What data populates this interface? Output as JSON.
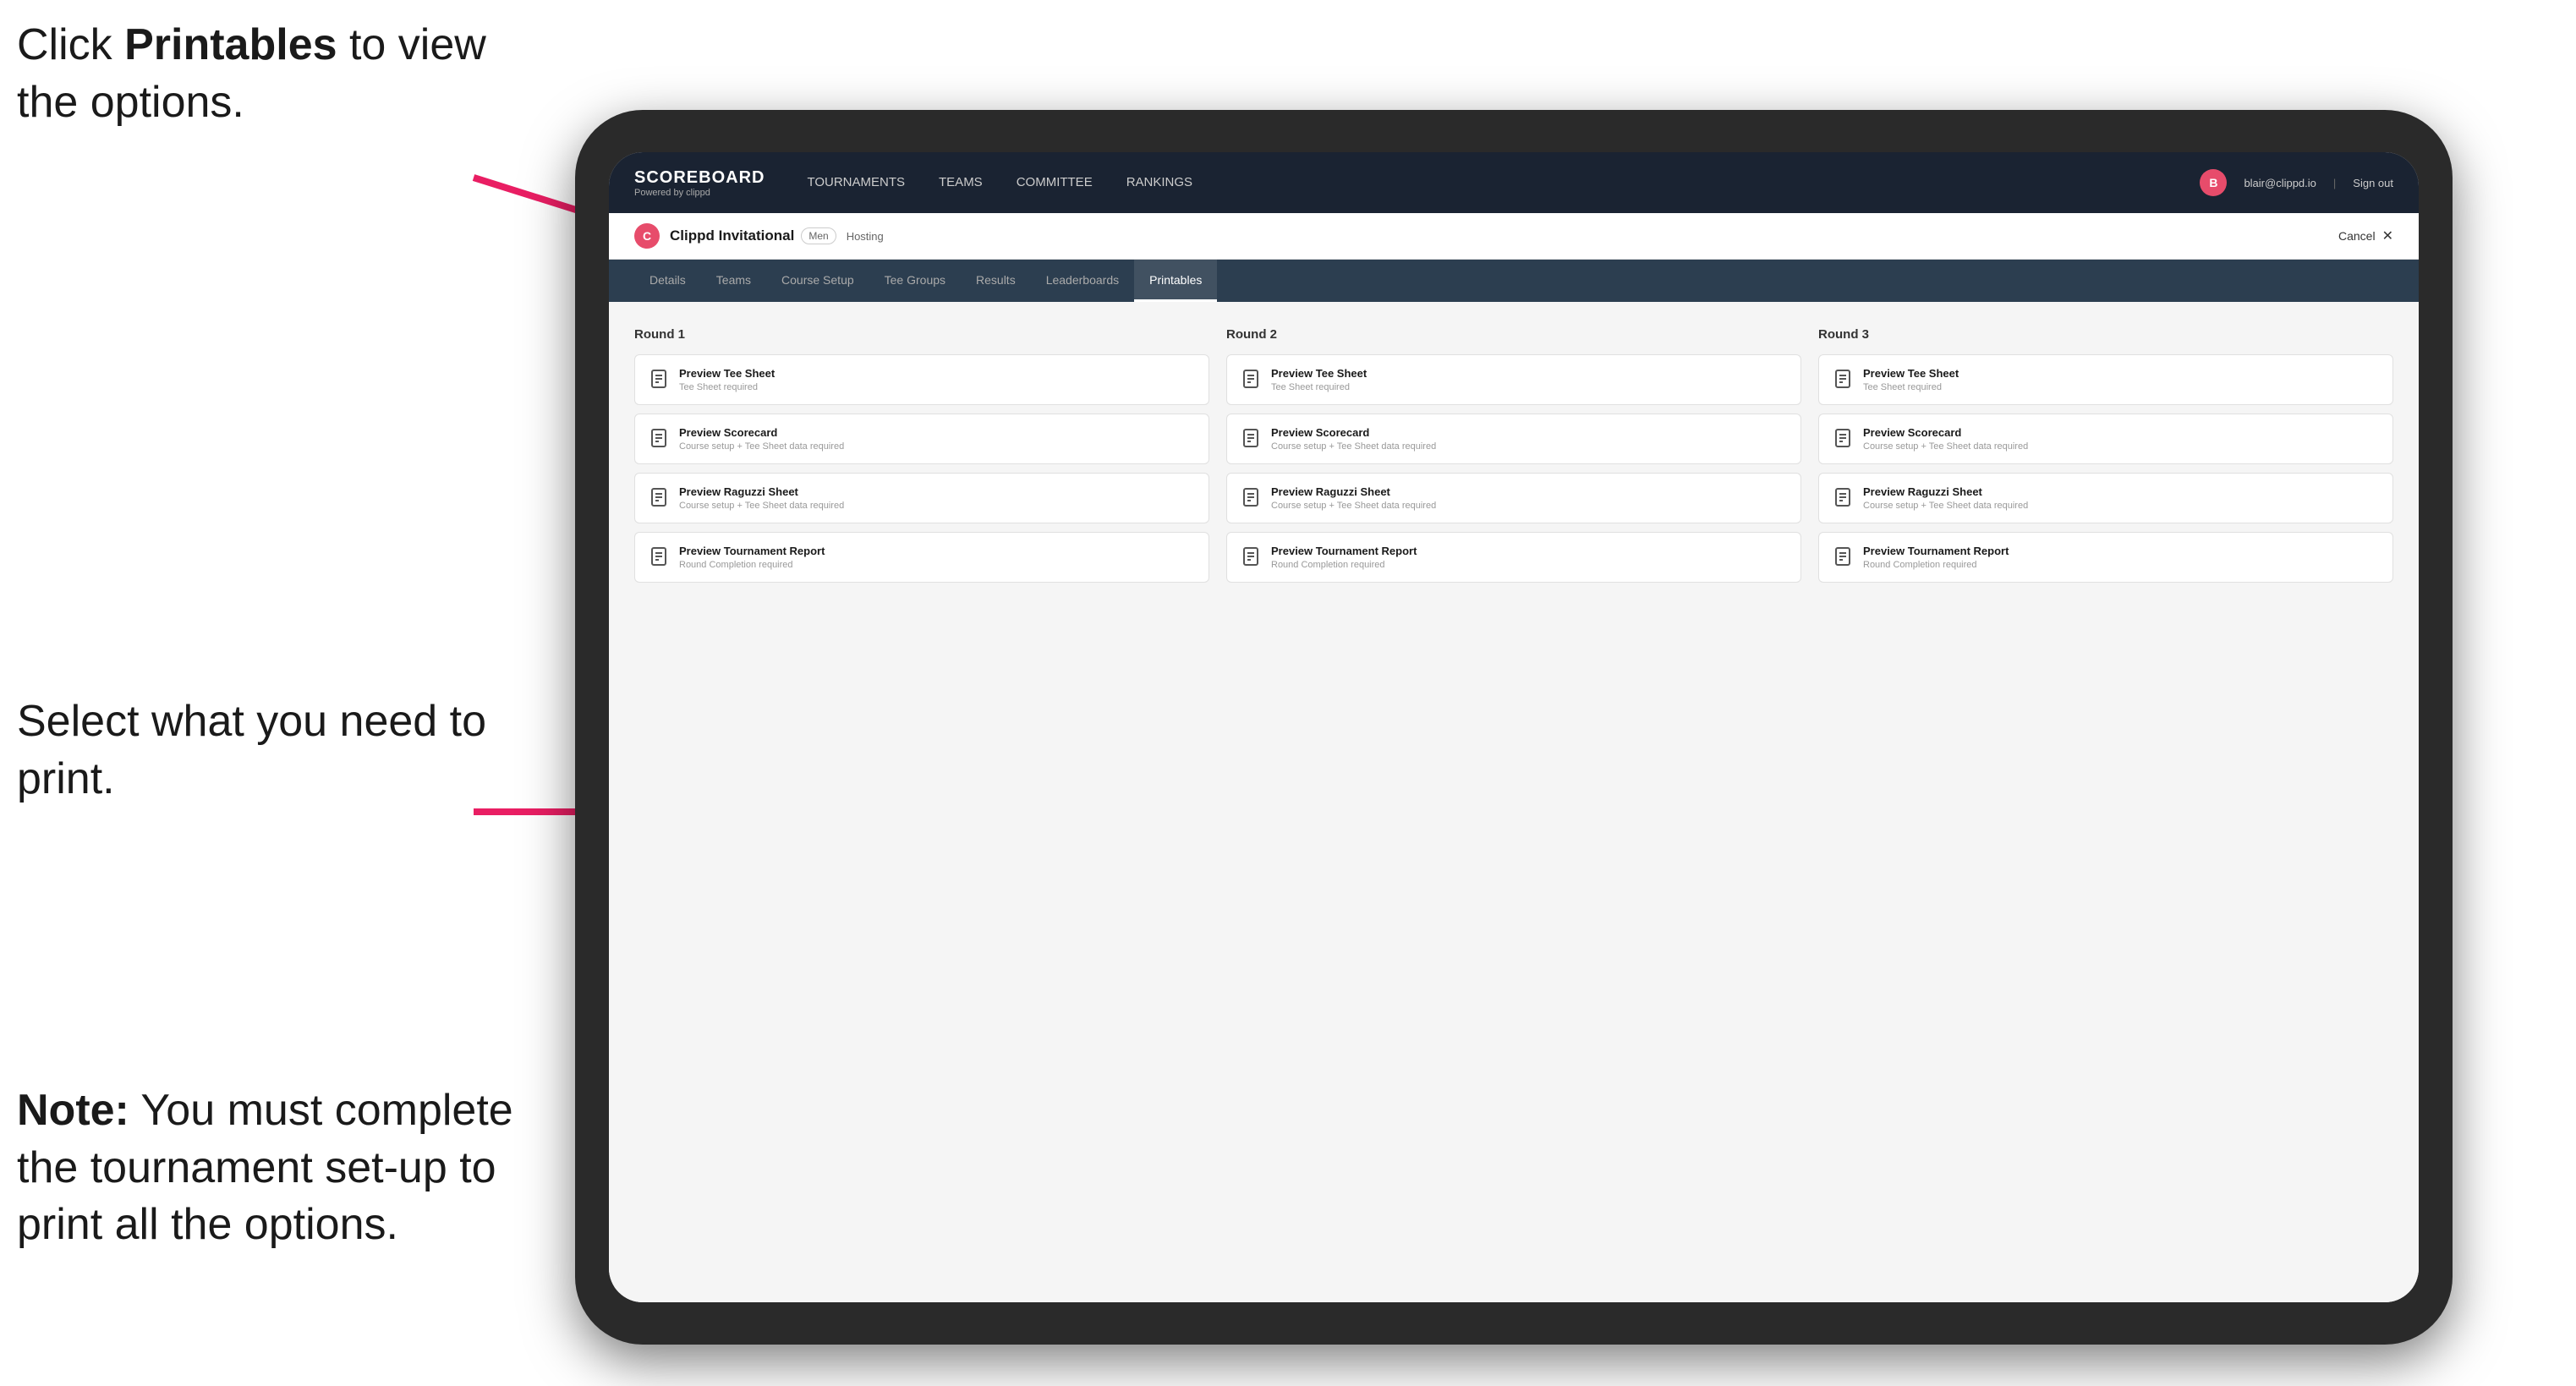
{
  "instructions": {
    "top": "Click Printables to view the options.",
    "top_bold": "Printables",
    "middle": "Select what you need to print.",
    "bottom_note": "Note:",
    "bottom_text": "You must complete the tournament set-up to print all the options."
  },
  "nav": {
    "brand": "SCOREBOARD",
    "brand_sub": "Powered by clippd",
    "links": [
      "TOURNAMENTS",
      "TEAMS",
      "COMMITTEE",
      "RANKINGS"
    ],
    "user_email": "blair@clippd.io",
    "signout": "Sign out"
  },
  "sub_header": {
    "tournament_name": "Clippd Invitational",
    "badge": "Men",
    "status": "Hosting",
    "cancel": "Cancel"
  },
  "tabs": [
    "Details",
    "Teams",
    "Course Setup",
    "Tee Groups",
    "Results",
    "Leaderboards",
    "Printables"
  ],
  "active_tab": "Printables",
  "rounds": [
    {
      "title": "Round 1",
      "items": [
        {
          "title": "Preview Tee Sheet",
          "subtitle": "Tee Sheet required"
        },
        {
          "title": "Preview Scorecard",
          "subtitle": "Course setup + Tee Sheet data required"
        },
        {
          "title": "Preview Raguzzi Sheet",
          "subtitle": "Course setup + Tee Sheet data required"
        },
        {
          "title": "Preview Tournament Report",
          "subtitle": "Round Completion required"
        }
      ]
    },
    {
      "title": "Round 2",
      "items": [
        {
          "title": "Preview Tee Sheet",
          "subtitle": "Tee Sheet required"
        },
        {
          "title": "Preview Scorecard",
          "subtitle": "Course setup + Tee Sheet data required"
        },
        {
          "title": "Preview Raguzzi Sheet",
          "subtitle": "Course setup + Tee Sheet data required"
        },
        {
          "title": "Preview Tournament Report",
          "subtitle": "Round Completion required"
        }
      ]
    },
    {
      "title": "Round 3",
      "items": [
        {
          "title": "Preview Tee Sheet",
          "subtitle": "Tee Sheet required"
        },
        {
          "title": "Preview Scorecard",
          "subtitle": "Course setup + Tee Sheet data required"
        },
        {
          "title": "Preview Raguzzi Sheet",
          "subtitle": "Course setup + Tee Sheet data required"
        },
        {
          "title": "Preview Tournament Report",
          "subtitle": "Round Completion required"
        }
      ]
    }
  ]
}
